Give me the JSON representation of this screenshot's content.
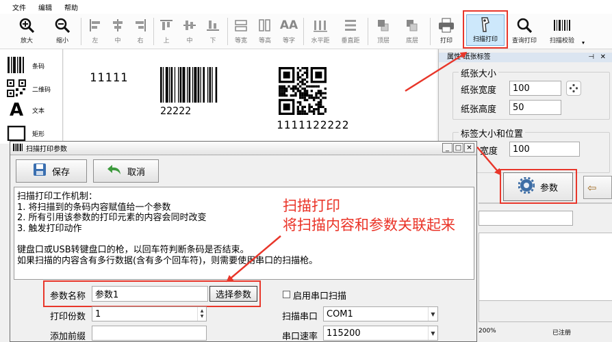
{
  "menu": [
    "文件",
    "编辑",
    "帮助"
  ],
  "toolbar": [
    {
      "icon": "zoom-in-icon",
      "label": "放大"
    },
    {
      "icon": "zoom-out-icon",
      "label": "缩小"
    },
    {
      "icon": "align-left-icon",
      "label": "左"
    },
    {
      "icon": "align-center-icon",
      "label": "中"
    },
    {
      "icon": "align-right-icon",
      "label": "右"
    },
    {
      "icon": "align-top-icon",
      "label": "上"
    },
    {
      "icon": "align-middle-icon",
      "label": "中"
    },
    {
      "icon": "align-bottom-icon",
      "label": "下"
    },
    {
      "icon": "equal-width-icon",
      "label": "等宽"
    },
    {
      "icon": "equal-height-icon",
      "label": "等高"
    },
    {
      "icon": "equal-font-icon",
      "label": "等字"
    },
    {
      "icon": "horizontal-spacing-icon",
      "label": "水平距"
    },
    {
      "icon": "vertical-spacing-icon",
      "label": "垂直距"
    },
    {
      "icon": "bring-to-front-icon",
      "label": "顶层"
    },
    {
      "icon": "send-to-back-icon",
      "label": "底层"
    },
    {
      "icon": "printer-icon",
      "label": "打印"
    },
    {
      "icon": "barcode-scanner-icon",
      "label": "扫描打印"
    },
    {
      "icon": "search-print-icon",
      "label": "查询打印"
    },
    {
      "icon": "barcode-verify-icon",
      "label": "扫描校验"
    }
  ],
  "palette": [
    {
      "icon": "barcode-icon",
      "label": "条码"
    },
    {
      "icon": "qrcode-icon",
      "label": "二维码"
    },
    {
      "icon": "text-icon",
      "label": "文本"
    },
    {
      "icon": "rectangle-icon",
      "label": "矩形"
    }
  ],
  "canvas": {
    "text1": "11111",
    "barcode_text": "22222",
    "qr_text": "1111122222"
  },
  "panel": {
    "title": "属性-纸张标签",
    "paper_group": "纸张大小",
    "paper_width_label": "纸张宽度",
    "paper_width": "100",
    "paper_height_label": "纸张高度",
    "paper_height": "50",
    "label_group": "标签大小和位置",
    "label_width_label": "宽度",
    "label_width": "100",
    "params_button": "参数",
    "zoom": "200%",
    "status": "已注册"
  },
  "dialog": {
    "title": "扫描打印参数",
    "save": "保存",
    "cancel": "取消",
    "description": [
      "扫描打印工作机制：",
      "1. 将扫描到的条码内容赋值给一个参数",
      "2. 所有引用该参数的打印元素的内容会同时改变",
      "3. 触发打印动作",
      "",
      "键盘口或USB转键盘口的枪，以回车符判断条码是否结束。",
      "如果扫描的内容含有多行数据(含有多个回车符)，则需要使用串口的扫描枪。"
    ],
    "annotation_line1": "扫描打印",
    "annotation_line2": "将扫描内容和参数关联起来",
    "param_name_label": "参数名称",
    "param_name": "参数1",
    "select_param": "选择参数",
    "copies_label": "打印份数",
    "copies": "1",
    "prefix_label": "添加前缀",
    "prefix": "",
    "serial_scan_label": "启用串口扫描",
    "serial_scan_checked": false,
    "serial_port_label": "扫描串口",
    "serial_port": "COM1",
    "baud_label": "串口速率",
    "baud": "115200"
  },
  "colors": {
    "highlight": "#e8362a",
    "annotation": "#ea3327",
    "selected_tool": "#cde8fb"
  }
}
